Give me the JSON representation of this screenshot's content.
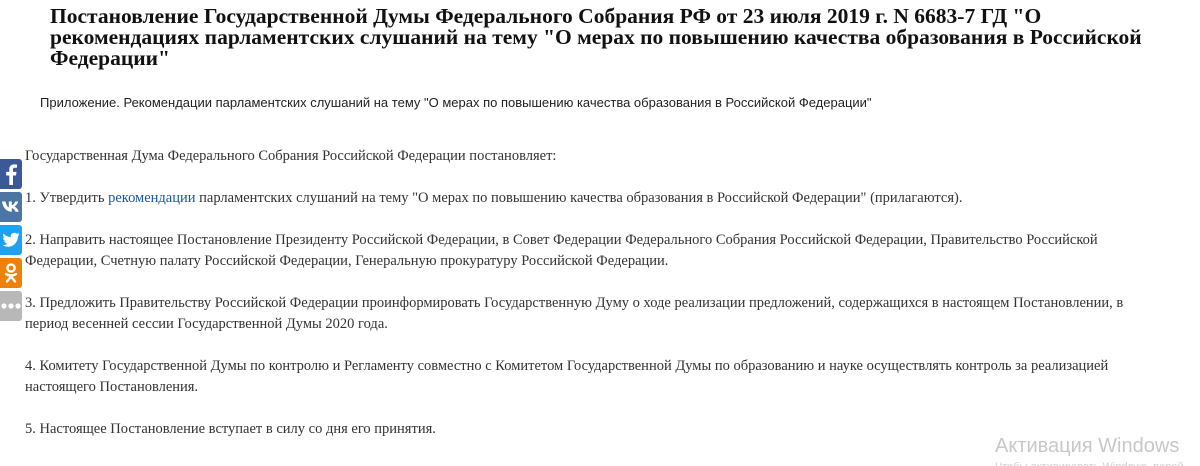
{
  "document": {
    "title": "Постановление Государственной Думы Федерального Собрания РФ от 23 июля 2019 г. N 6683-7 ГД \"О рекомендациях парламентских слушаний на тему \"О мерах по повышению качества образования в Российской Федерации\"",
    "appendix": "Приложение. Рекомендации парламентских слушаний на тему \"О мерах по повышению качества образования в Российской Федерации\"",
    "intro": "Государственная Дума Федерального Собрания Российской Федерации постановляет:",
    "item1_before_link": "1. Утвердить ",
    "item1_link": "рекомендации",
    "item1_after_link": " парламентских слушаний на тему \"О мерах по повышению качества образования в Российской Федерации\" (прилагаются).",
    "item2": "2. Направить настоящее Постановление Президенту Российской Федерации, в Совет Федерации Федерального Собрания Российской Федерации, Правительство Российской Федерации, Счетную палату Российской Федерации, Генеральную прокуратуру Российской Федерации.",
    "item3": "3. Предложить Правительству Российской Федерации проинформировать Государственную Думу о ходе реализации предложений, содержащихся в настоящем Постановлении, в период весенней сессии Государственной Думы 2020 года.",
    "item4": "4. Комитету Государственной Думы по контролю и Регламенту совместно с Комитетом Государственной Думы по образованию и науке осуществлять контроль за реализацией настоящего Постановления.",
    "item5": "5. Настоящее Постановление вступает в силу со дня его принятия."
  },
  "share_bar": {
    "buttons": [
      {
        "icon": "facebook-icon",
        "color": "#3b5998"
      },
      {
        "icon": "vk-icon",
        "color": "#4c75a3"
      },
      {
        "icon": "twitter-icon",
        "color": "#1da1f2"
      },
      {
        "icon": "odnoklassniki-icon",
        "color": "#ee8208"
      },
      {
        "icon": "more-icon",
        "color": "#b8b8b8"
      }
    ]
  },
  "watermark": {
    "title": "Активация Windows",
    "subtitle": "Чтобы активировать Windows, перейдите в раздел \"Параметры\"."
  }
}
